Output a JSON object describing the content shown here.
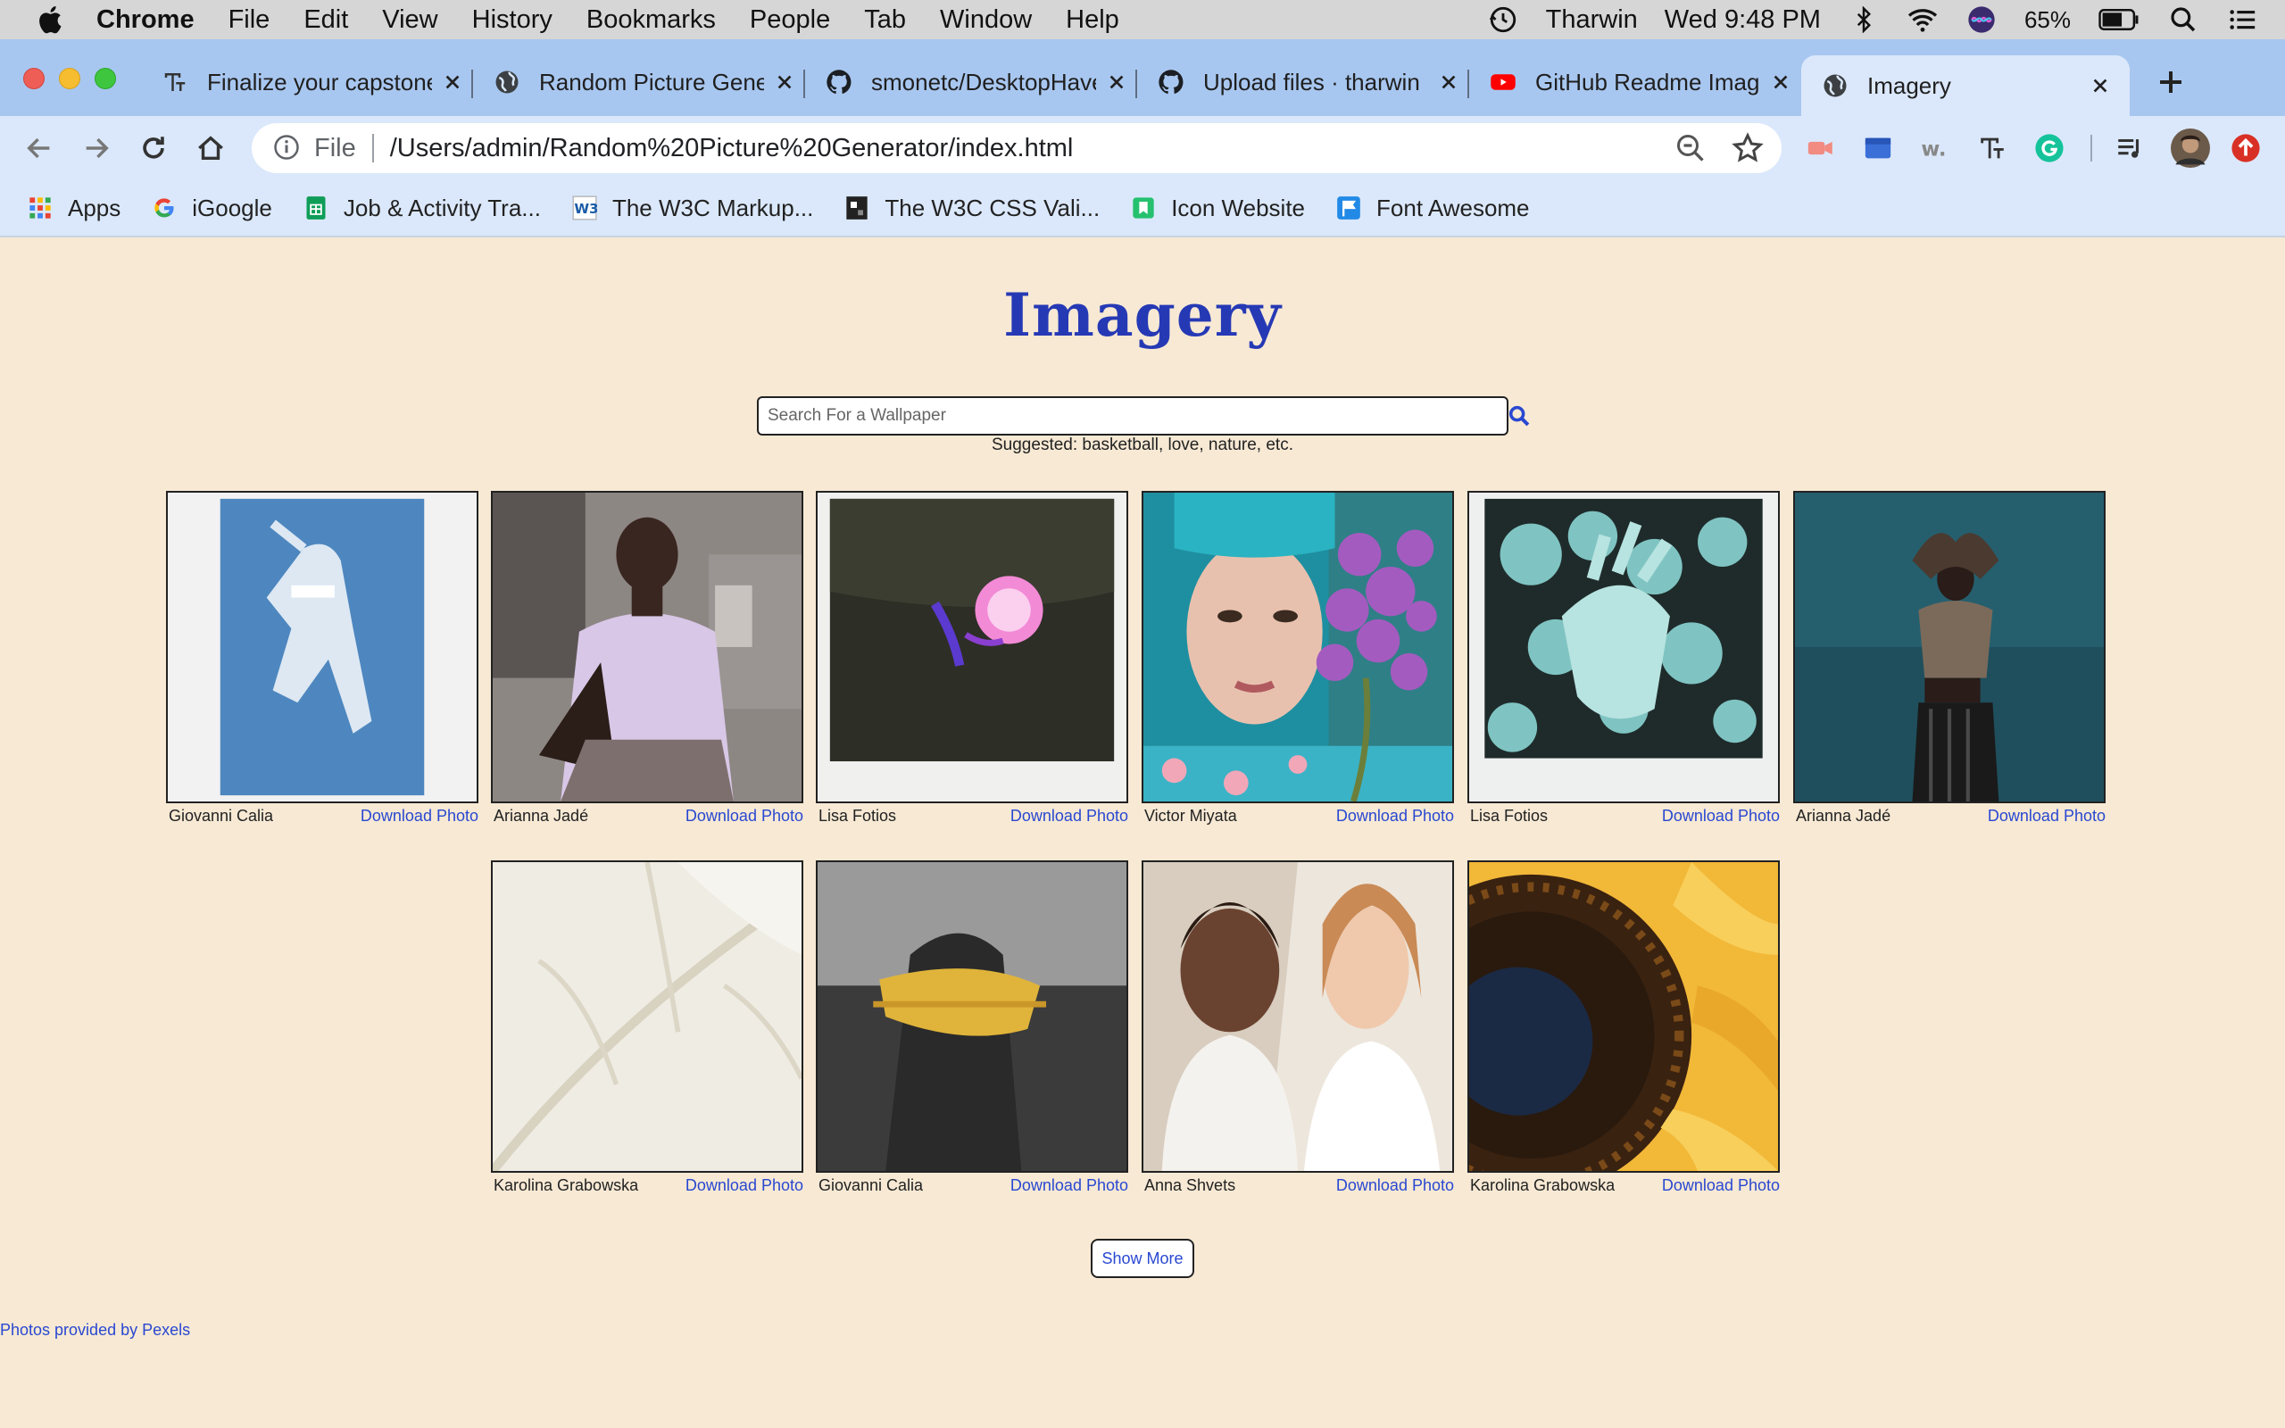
{
  "menubar": {
    "app_name": "Chrome",
    "items": [
      "File",
      "Edit",
      "View",
      "History",
      "Bookmarks",
      "People",
      "Tab",
      "Window",
      "Help"
    ],
    "user": "Tharwin",
    "clock": "Wed 9:48 PM",
    "battery": "65%"
  },
  "tabs": [
    {
      "title": "Finalize your capstone",
      "favicon": "text-format-icon"
    },
    {
      "title": "Random Picture Generator",
      "favicon": "globe-icon"
    },
    {
      "title": "smonetc/DesktopHaven",
      "favicon": "github-icon"
    },
    {
      "title": "Upload files · tharwin",
      "favicon": "github-icon"
    },
    {
      "title": "GitHub Readme Images",
      "favicon": "youtube-icon"
    },
    {
      "title": "Imagery",
      "favicon": "globe-icon"
    }
  ],
  "omnibox": {
    "scheme": "File",
    "url": "/Users/admin/Random%20Picture%20Generator/index.html"
  },
  "bookmarks": [
    {
      "label": "Apps",
      "icon": "apps-grid-icon"
    },
    {
      "label": "iGoogle",
      "icon": "google-icon"
    },
    {
      "label": "Job & Activity Tra...",
      "icon": "sheets-icon"
    },
    {
      "label": "The W3C Markup...",
      "icon": "w3c-icon"
    },
    {
      "label": "The W3C CSS Vali...",
      "icon": "css-validator-icon"
    },
    {
      "label": "Icon Website",
      "icon": "icon-website-icon"
    },
    {
      "label": "Font Awesome",
      "icon": "flag-icon"
    }
  ],
  "page": {
    "title": "Imagery",
    "search_placeholder": "Search For a Wallpaper",
    "suggested": "Suggested: basketball, love, nature, etc.",
    "download_label": "Download Photo",
    "show_more": "Show More",
    "credit": "Photos provided by Pexels"
  },
  "photos": [
    {
      "author": "Giovanni Calia"
    },
    {
      "author": "Arianna Jadé"
    },
    {
      "author": "Lisa Fotios"
    },
    {
      "author": "Victor Miyata"
    },
    {
      "author": "Lisa Fotios"
    },
    {
      "author": "Arianna Jadé"
    },
    {
      "author": "Karolina Grabowska"
    },
    {
      "author": "Giovanni Calia"
    },
    {
      "author": "Anna Shvets"
    },
    {
      "author": "Karolina Grabowska"
    }
  ],
  "colors": {
    "page_background": "#f7e9d4",
    "title_blue": "#2639b5",
    "link_blue": "#2948d1",
    "tab_strip": "#a8c7f0",
    "toolbar": "#dbe8fb"
  }
}
